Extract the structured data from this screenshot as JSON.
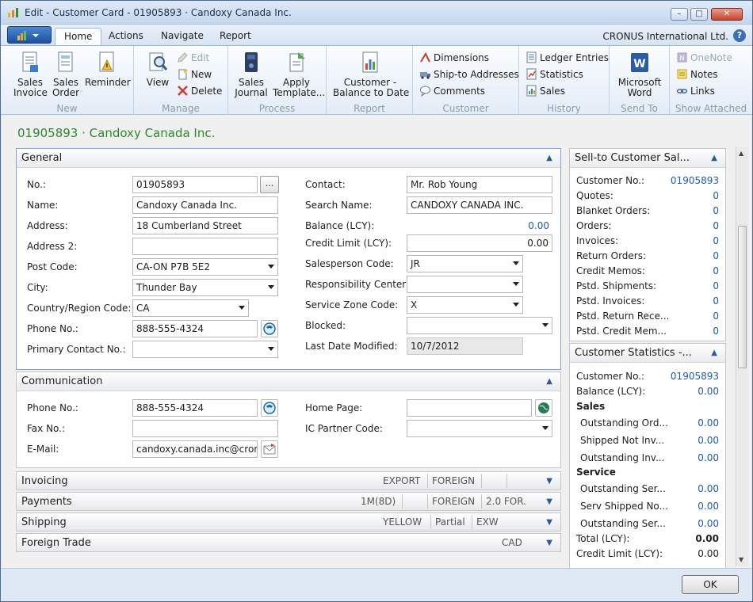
{
  "window": {
    "title": "Edit - Customer Card - 01905893 · Candoxy Canada Inc."
  },
  "tabs": [
    "Home",
    "Actions",
    "Navigate",
    "Report"
  ],
  "company": "CRONUS International Ltd.",
  "help_label": "?",
  "ribbon": {
    "new": {
      "label": "New",
      "sales_invoice": "Sales\nInvoice",
      "sales_order": "Sales\nOrder",
      "reminder": "Reminder"
    },
    "manage": {
      "label": "Manage",
      "view": "View",
      "edit": "Edit",
      "new": "New",
      "delete": "Delete"
    },
    "process": {
      "label": "Process",
      "sales_journal": "Sales\nJournal",
      "apply_template": "Apply\nTemplate..."
    },
    "report": {
      "label": "Report",
      "customer_balance": "Customer -\nBalance to Date"
    },
    "customer": {
      "label": "Customer",
      "dimensions": "Dimensions",
      "ship_to": "Ship-to Addresses",
      "comments": "Comments"
    },
    "history": {
      "label": "History",
      "ledger_entries": "Ledger Entries",
      "statistics": "Statistics",
      "sales": "Sales"
    },
    "send_to": {
      "label": "Send To",
      "word": "Microsoft\nWord"
    },
    "show_attached": {
      "label": "Show Attached",
      "onenote": "OneNote",
      "notes": "Notes",
      "links": "Links"
    }
  },
  "page_title": "01905893 · Candoxy Canada Inc.",
  "general": {
    "title": "General",
    "no_label": "No.:",
    "no": "01905893",
    "name_label": "Name:",
    "name": "Candoxy Canada Inc.",
    "address_label": "Address:",
    "address": "18 Cumberland Street",
    "address2_label": "Address 2:",
    "address2": "",
    "post_code_label": "Post Code:",
    "post_code": "CA-ON P7B 5E2",
    "city_label": "City:",
    "city": "Thunder Bay",
    "country_label": "Country/Region Code:",
    "country": "CA",
    "phone_label": "Phone No.:",
    "phone": "888-555-4324",
    "primary_contact_label": "Primary Contact No.:",
    "primary_contact": "",
    "contact_label": "Contact:",
    "contact": "Mr. Rob Young",
    "search_name_label": "Search Name:",
    "search_name": "CANDOXY CANADA INC.",
    "balance_label": "Balance (LCY):",
    "balance": "0.00",
    "credit_limit_label": "Credit Limit (LCY):",
    "credit_limit": "0.00",
    "salesperson_label": "Salesperson Code:",
    "salesperson": "JR",
    "resp_center_label": "Responsibility Center:",
    "resp_center": "",
    "service_zone_label": "Service Zone Code:",
    "service_zone": "X",
    "blocked_label": "Blocked:",
    "blocked": "",
    "last_modified_label": "Last Date Modified:",
    "last_modified": "10/7/2012"
  },
  "communication": {
    "title": "Communication",
    "phone_label": "Phone No.:",
    "phone": "888-555-4324",
    "fax_label": "Fax No.:",
    "fax": "",
    "email_label": "E-Mail:",
    "email": "candoxy.canada.inc@cron...",
    "home_page_label": "Home Page:",
    "home_page": "",
    "ic_partner_label": "IC Partner Code:",
    "ic_partner": ""
  },
  "invoicing": {
    "title": "Invoicing",
    "s1": "EXPORT",
    "s2": "FOREIGN"
  },
  "payments": {
    "title": "Payments",
    "s1": "1M(8D)",
    "s2": "FOREIGN",
    "s3": "2.0 FOR."
  },
  "shipping": {
    "title": "Shipping",
    "s1": "YELLOW",
    "s2": "Partial",
    "s3": "EXW"
  },
  "foreign_trade": {
    "title": "Foreign Trade",
    "s1": "CAD"
  },
  "factbox_sales": {
    "title": "Sell-to Customer Sal...",
    "rows": [
      {
        "label": "Customer No.:",
        "value": "01905893"
      },
      {
        "label": "Quotes:",
        "value": "0"
      },
      {
        "label": "Blanket Orders:",
        "value": "0"
      },
      {
        "label": "Orders:",
        "value": "0"
      },
      {
        "label": "Invoices:",
        "value": "0"
      },
      {
        "label": "Return Orders:",
        "value": "0"
      },
      {
        "label": "Credit Memos:",
        "value": "0"
      },
      {
        "label": "Pstd. Shipments:",
        "value": "0"
      },
      {
        "label": "Pstd. Invoices:",
        "value": "0"
      },
      {
        "label": "Pstd. Return Rece...",
        "value": "0"
      },
      {
        "label": "Pstd. Credit Mem...",
        "value": "0"
      }
    ]
  },
  "factbox_stats": {
    "title": "Customer Statistics -...",
    "customer_no_label": "Customer No.:",
    "customer_no": "01905893",
    "balance_label": "Balance (LCY):",
    "balance": "0.00",
    "sales_heading": "Sales",
    "outstanding_orders_label": "Outstanding Ord...",
    "outstanding_orders": "0.00",
    "shipped_not_inv_label": "Shipped Not Inv...",
    "shipped_not_inv": "0.00",
    "outstanding_inv_label": "Outstanding Inv...",
    "outstanding_inv": "0.00",
    "service_heading": "Service",
    "outstanding_ser1_label": "Outstanding Ser...",
    "outstanding_ser1": "0.00",
    "serv_shipped_label": "Serv Shipped No...",
    "serv_shipped": "0.00",
    "outstanding_ser2_label": "Outstanding Ser...",
    "outstanding_ser2": "0.00",
    "total_label": "Total (LCY):",
    "total": "0.00",
    "credit_limit_label": "Credit Limit (LCY):",
    "credit_limit": "0.00"
  },
  "ok_label": "OK"
}
